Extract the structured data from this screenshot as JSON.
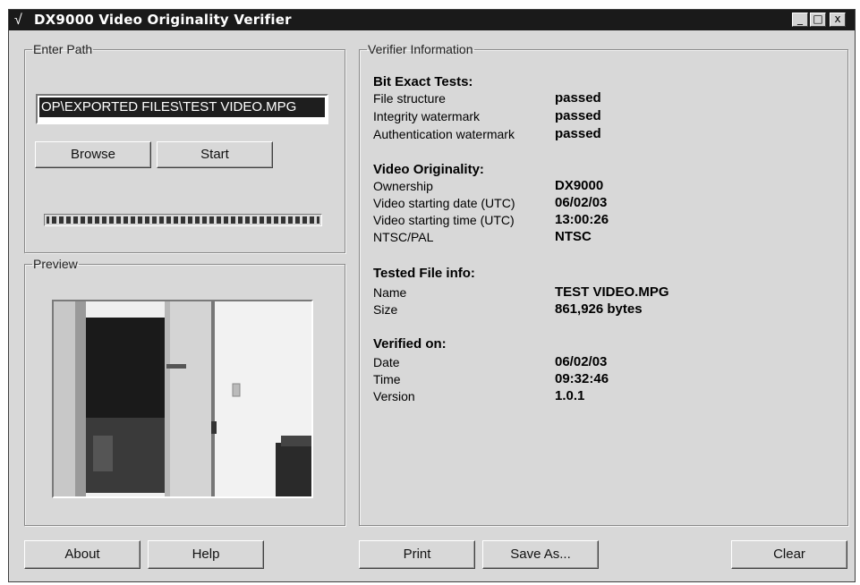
{
  "window": {
    "title": "DX9000 Video Originality Verifier",
    "check_glyph": "√",
    "caption_buttons": {
      "minimize": "_",
      "maximize": "□",
      "close": "x"
    }
  },
  "enter_path": {
    "legend": "Enter Path",
    "path_value": "OP\\EXPORTED FILES\\TEST VIDEO.MPG",
    "browse_label": "Browse",
    "start_label": "Start",
    "progress": 1.0
  },
  "preview": {
    "legend": "Preview"
  },
  "verifier": {
    "legend": "Verifier Information",
    "sections": [
      {
        "heading": "Bit Exact Tests:",
        "rows": [
          {
            "label": "File structure",
            "value": "passed"
          },
          {
            "label": "Integrity watermark",
            "value": "passed"
          },
          {
            "label": "Authentication watermark",
            "value": "passed"
          }
        ]
      },
      {
        "heading": "Video Originality:",
        "rows": [
          {
            "label": "Ownership",
            "value": "DX9000"
          },
          {
            "label": "Video starting date (UTC)",
            "value": "06/02/03"
          },
          {
            "label": "Video starting  time (UTC)",
            "value": "13:00:26"
          },
          {
            "label": "NTSC/PAL",
            "value": "NTSC"
          }
        ]
      },
      {
        "heading": "Tested File info:",
        "rows": [
          {
            "label": "Name",
            "value": "TEST VIDEO.MPG"
          },
          {
            "label": "Size",
            "value": "861,926 bytes"
          }
        ]
      },
      {
        "heading": "Verified on:",
        "rows": [
          {
            "label": "Date",
            "value": "06/02/03"
          },
          {
            "label": "Time",
            "value": "09:32:46"
          },
          {
            "label": "Version",
            "value": "1.0.1"
          }
        ]
      }
    ]
  },
  "footer": {
    "about_label": "About",
    "help_label": "Help",
    "print_label": "Print",
    "save_as_label": "Save As...",
    "clear_label": "Clear"
  }
}
